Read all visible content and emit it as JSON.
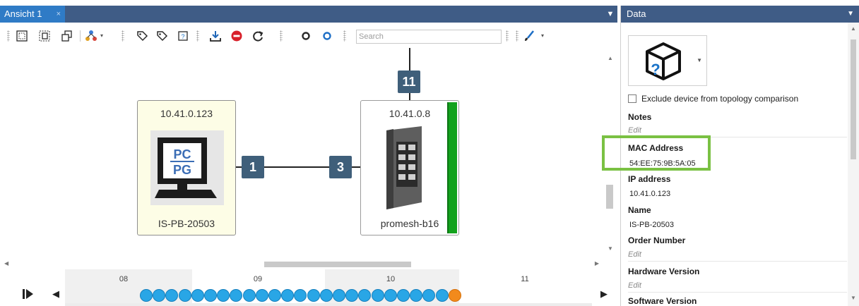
{
  "tab": {
    "label": "Ansicht 1",
    "close": "×"
  },
  "toolbar": {
    "search_placeholder": "Search"
  },
  "topology": {
    "devices": [
      {
        "ip": "10.41.0.123",
        "name": "IS-PB-20503",
        "icon_text_top": "PC",
        "icon_text_bottom": "PG"
      },
      {
        "ip": "10.41.0.8",
        "name": "promesh-b16"
      }
    ],
    "ports": {
      "pc_port": "1",
      "switch_port_left": "3",
      "switch_port_top": "11"
    }
  },
  "timeline": {
    "labels": [
      "08",
      "09",
      "10",
      "11"
    ],
    "dot_count": 25,
    "colors": {
      "event": "#29a6e6",
      "last_event": "#f28a1c"
    }
  },
  "data_panel": {
    "title": "Data",
    "exclude_label": "Exclude device from topology comparison",
    "notes_label": "Notes",
    "notes_value": "Edit",
    "mac_label": "MAC Address",
    "mac_value": "54:EE:75:9B:5A:05",
    "ip_label": "IP address",
    "ip_value": "10.41.0.123",
    "name_label": "Name",
    "name_value": "IS-PB-20503",
    "order_label": "Order Number",
    "order_value": "Edit",
    "hw_label": "Hardware Version",
    "hw_value": "Edit",
    "sw_label": "Software Version"
  },
  "colors": {
    "header_bg": "#3f5c86",
    "tab_active": "#2f7bc6",
    "port_badge": "#3f5f7a",
    "status_green": "#13a21d",
    "highlight": "#7ac143"
  }
}
